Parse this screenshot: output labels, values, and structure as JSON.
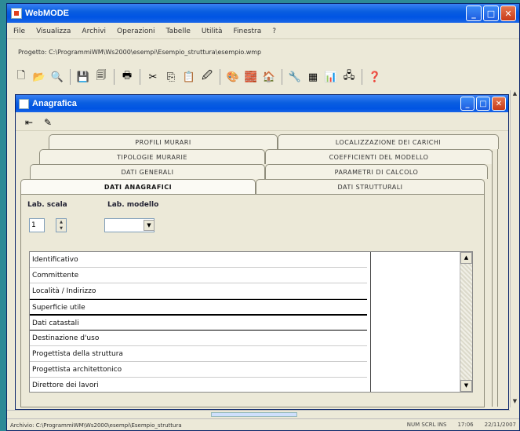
{
  "app": {
    "title": "WebMODE",
    "window_buttons": {
      "minimize": "_",
      "maximize": "□",
      "close": "✕"
    }
  },
  "menu": [
    "File",
    "Visualizza",
    "Archivi",
    "Operazioni",
    "Tabelle",
    "Utilità",
    "Finestra",
    "?"
  ],
  "path": "Progetto: C:\\ProgrammiWM\\Ws2000\\esempi\\Esempio_struttura\\esempio.wmp",
  "toolbar_icons": [
    "new-icon",
    "open-icon",
    "find-icon",
    "save-icon",
    "save-all-icon",
    "print-icon",
    "cut-icon",
    "copy-icon",
    "paste-icon",
    "wizard-icon",
    "color-icon",
    "box-icon",
    "building-icon",
    "tools-icon",
    "grid-icon",
    "chart-icon",
    "network-icon",
    "help-icon"
  ],
  "child": {
    "title": "Anagrafica",
    "buttons": {
      "minimize": "_",
      "maximize": "□",
      "close": "✕"
    }
  },
  "tabs": {
    "row1": [
      "PROFILI MURARI",
      "LOCALIZZAZIONE DEI CARICHI"
    ],
    "row2": [
      "TIPOLOGIE MURARIE",
      "COEFFICIENTI DEL MODELLO"
    ],
    "row3": [
      "DATI GENERALI",
      "PARAMETRI DI CALCOLO"
    ],
    "row4": [
      "DATI ANAGRAFICI",
      "DATI STRUTTURALI"
    ]
  },
  "fields": {
    "label1": "Lab. scala",
    "label2": "Lab. modello",
    "spin_value": "1",
    "combo_value": ""
  },
  "grid_rows": [
    "Identificativo",
    "Committente",
    "Località / Indirizzo",
    "Superficie utile",
    "Dati catastali",
    "Destinazione d'uso",
    "Progettista della struttura",
    "Progettista architettonico",
    "Direttore dei lavori"
  ],
  "statusbar": {
    "left": "Archivio: C:\\ProgrammiWM\\Ws2000\\esempi\\Esempio_struttura",
    "mid": "NUM SCRL INS",
    "right_time": "17:06",
    "right_date": "22/11/2007"
  }
}
